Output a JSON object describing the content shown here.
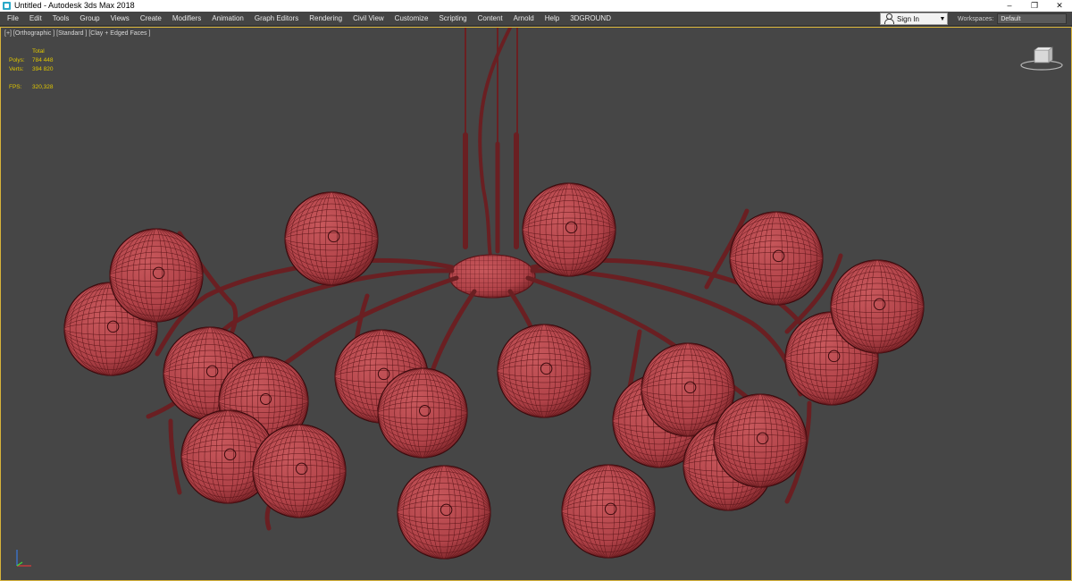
{
  "window": {
    "title": "Untitled - Autodesk 3ds Max 2018",
    "controls": [
      "–",
      "❐",
      "✕"
    ]
  },
  "menu": {
    "items": [
      "File",
      "Edit",
      "Tools",
      "Group",
      "Views",
      "Create",
      "Modifiers",
      "Animation",
      "Graph Editors",
      "Rendering",
      "Civil View",
      "Customize",
      "Scripting",
      "Content",
      "Arnold",
      "Help",
      "3DGROUND"
    ],
    "signin_label": "Sign In",
    "workspaces_label": "Workspaces:",
    "workspaces_value": "Default"
  },
  "viewport": {
    "label": "[+] [Orthographic ] [Standard ] [Clay + Edged Faces ]",
    "stats": {
      "header": "Total",
      "polys_label": "Polys:",
      "polys_value": "784 448",
      "verts_label": "Verts:",
      "verts_value": "394 820",
      "fps_label": "FPS:",
      "fps_value": "320,328"
    },
    "colors": {
      "background": "#464646",
      "sphere": "#b84a4e",
      "wire": "#5a1418",
      "stem": "#6a1f22",
      "border": "#d7b33a",
      "stats_text": "#e0c700"
    },
    "icons": {
      "viewcube": "viewcube-icon",
      "axis": "axis-tripod-icon"
    }
  }
}
